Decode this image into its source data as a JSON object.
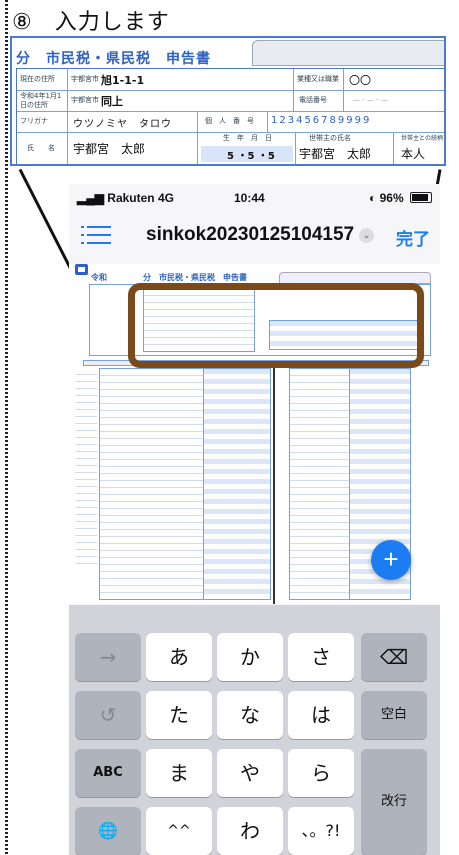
{
  "heading": {
    "step_number": "⑧",
    "text": "入力します"
  },
  "form_zoom": {
    "title": "分　市民税・県民税　申告書",
    "address_label": "現在の住所",
    "address_prefix": "宇都宮市",
    "address_value": "旭1-1-1",
    "prev_address_label": "令和4年1月1日の住所",
    "prev_address_prefix": "宇都宮市",
    "prev_address_value": "同上",
    "business_label": "業種又は職業",
    "business_value": "〇〇",
    "phone_label": "電話番号",
    "phone_value": "— - — - —",
    "furigana_label": "フリガナ",
    "furigana_value": "ウツノミヤ　タロウ",
    "personal_number_label": "個　人　番　号",
    "personal_number_value": "123456789999",
    "name_label": "氏　　名",
    "name_value": "宇都宮　太郎",
    "birth_label": "生　年　月　日",
    "birth_value": "5 ・5 ・5",
    "head_label": "世帯主の氏名",
    "head_value": "宇都宮　太郎",
    "relation_label": "世帯主との続柄",
    "relation_value": "本人"
  },
  "status_bar": {
    "carrier": "Rakuten",
    "network": "4G",
    "time": "10:44",
    "battery": "96%"
  },
  "nav": {
    "title": "sinkok20230125104157",
    "done": "完了"
  },
  "doc": {
    "header": "分　市民税・県民税　申告書",
    "prefix": "令和"
  },
  "fab": {
    "label": "+"
  },
  "keyboard": {
    "rows": [
      [
        "→",
        "あ",
        "か",
        "さ",
        "⌫"
      ],
      [
        "↺",
        "た",
        "な",
        "は",
        "空白"
      ],
      [
        "ABC",
        "ま",
        "や",
        "ら",
        "改行"
      ],
      [
        "🌐",
        "^^",
        "わ",
        "、。?!"
      ]
    ],
    "icons": {
      "next": "arrow-right-icon",
      "undo": "undo-icon",
      "delete": "backspace-icon",
      "globe": "globe-icon"
    }
  },
  "colors": {
    "accent": "#1c7cf2",
    "highlight_border": "#7b4a1b",
    "form_blue": "#2f63c4"
  }
}
